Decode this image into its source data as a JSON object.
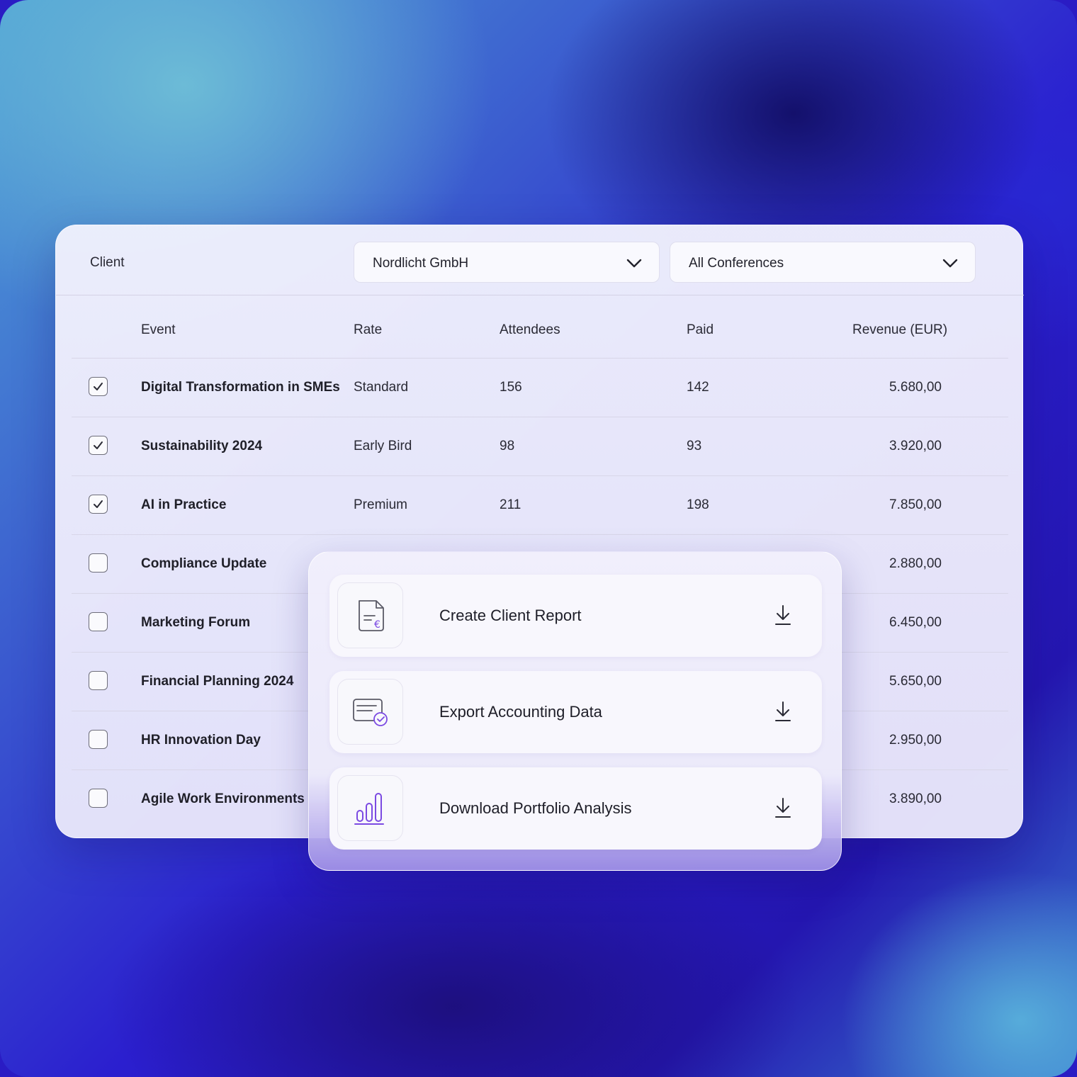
{
  "filters": {
    "client_label": "Client",
    "client_select": "Nordlicht GmbH",
    "conference_select": "All Conferences"
  },
  "table": {
    "headers": {
      "event": "Event",
      "rate": "Rate",
      "attendees": "Attendees",
      "paid": "Paid",
      "revenue": "Revenue (EUR)"
    },
    "rows": [
      {
        "checked": true,
        "event": "Digital Transformation in SMEs",
        "rate": "Standard",
        "attendees": "156",
        "paid": "142",
        "revenue": "5.680,00"
      },
      {
        "checked": true,
        "event": "Sustainability 2024",
        "rate": "Early Bird",
        "attendees": "98",
        "paid": "93",
        "revenue": "3.920,00"
      },
      {
        "checked": true,
        "event": "AI in Practice",
        "rate": "Premium",
        "attendees": "211",
        "paid": "198",
        "revenue": "7.850,00"
      },
      {
        "checked": false,
        "event": "Compliance Update",
        "rate": "",
        "attendees": "",
        "paid": "",
        "revenue": "2.880,00"
      },
      {
        "checked": false,
        "event": "Marketing Forum",
        "rate": "",
        "attendees": "",
        "paid": "",
        "revenue": "6.450,00"
      },
      {
        "checked": false,
        "event": "Financial Planning 2024",
        "rate": "",
        "attendees": "",
        "paid": "",
        "revenue": "5.650,00"
      },
      {
        "checked": false,
        "event": "HR Innovation Day",
        "rate": "",
        "attendees": "",
        "paid": "",
        "revenue": "2.950,00"
      },
      {
        "checked": false,
        "event": "Agile Work Environments",
        "rate": "",
        "attendees": "",
        "paid": "",
        "revenue": "3.890,00"
      }
    ]
  },
  "actions": [
    {
      "label": "Create Client Report",
      "icon": "euro-document-icon"
    },
    {
      "label": "Export Accounting Data",
      "icon": "card-check-icon"
    },
    {
      "label": "Download Portfolio Analysis",
      "icon": "bar-chart-icon"
    }
  ],
  "colors": {
    "accent": "#7b4ae2",
    "text": "#1f1f28"
  }
}
